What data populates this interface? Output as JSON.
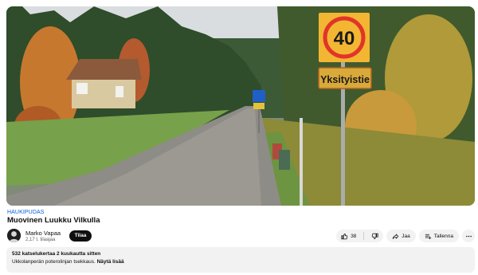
{
  "video": {
    "sign_speed_limit": "40",
    "sign_private_road": "Yksityistie"
  },
  "hashtag": "HAUKIPUDAS",
  "title": "Muovinen Luukku Vilkulla",
  "channel": {
    "name": "Marko Vapaa",
    "subscribers": "2,17 t. tilaajaa",
    "subscribe_label": "Tilaa"
  },
  "actions": {
    "like_count": "38",
    "share_label": "Jaa",
    "save_label": "Tallenna"
  },
  "description": {
    "stats": "532 katselukertaa  2 kuukautta sitten",
    "text": "Ukkolanperän poterolinjan tsekkaus.",
    "more_label": "Näytä lisää"
  },
  "icons": {
    "like": "thumbs-up-icon",
    "dislike": "thumbs-down-icon",
    "share": "share-arrow-icon",
    "save": "playlist-add-icon",
    "more": "more-horizontal-icon"
  }
}
